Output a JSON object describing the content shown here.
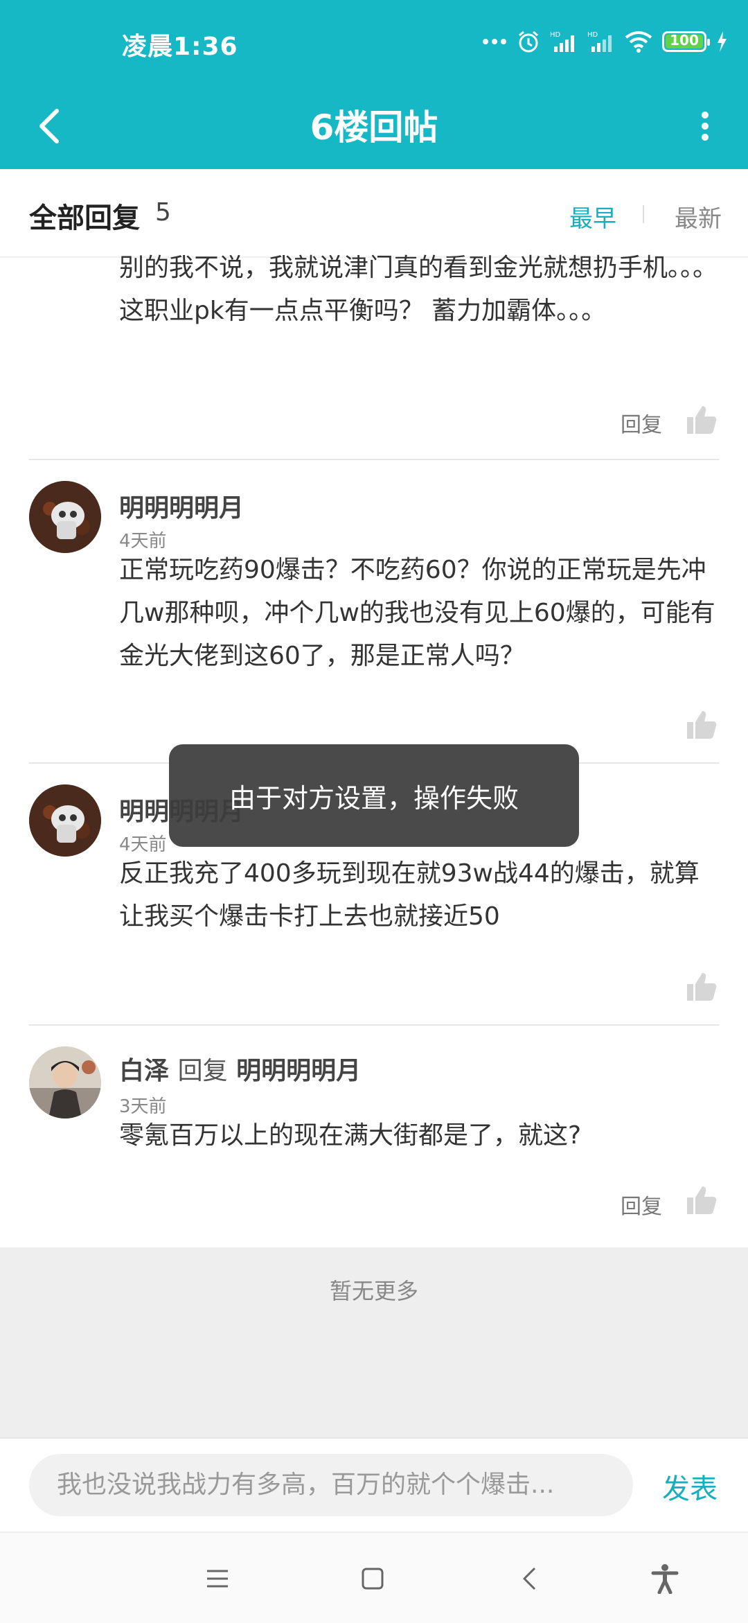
{
  "status_bar": {
    "time": "凌晨1:36",
    "battery": "100"
  },
  "app_bar": {
    "title": "6楼回帖"
  },
  "reply_header": {
    "title": "全部回复",
    "count": "5",
    "sort_earliest": "最早",
    "sort_newest": "最新"
  },
  "posts": [
    {
      "content": "别的我不说，我就说津门真的看到金光就想扔手机。。。这职业pk有一点点平衡吗？ 蓄力加霸体。。。",
      "reply_label": "回复"
    },
    {
      "name": "明明明明月",
      "time": "4天前",
      "content": "正常玩吃药90爆击？不吃药60？你说的正常玩是先冲几w那种呗，冲个几w的我也没有见上60爆的，可能有金光大佬到这60了，那是正常人吗？"
    },
    {
      "name": "明明明明月",
      "time": "4天前",
      "content": "反正我充了400多玩到现在就93w战44的爆击，就算让我买个爆击卡打上去也就接近50"
    },
    {
      "name": "白泽",
      "reply_word": "回复",
      "reply_to": "明明明明月",
      "time": "3天前",
      "content": "零氪百万以上的现在满大街都是了，就这?",
      "reply_label": "回复"
    }
  ],
  "no_more": "暂无更多",
  "input_bar": {
    "draft": "我也没说我战力有多高，百万的就个个爆击...",
    "send_label": "发表"
  },
  "toast": "由于对方设置，操作失败",
  "colors": {
    "accent": "#17b8c6",
    "link": "#17aebf"
  }
}
